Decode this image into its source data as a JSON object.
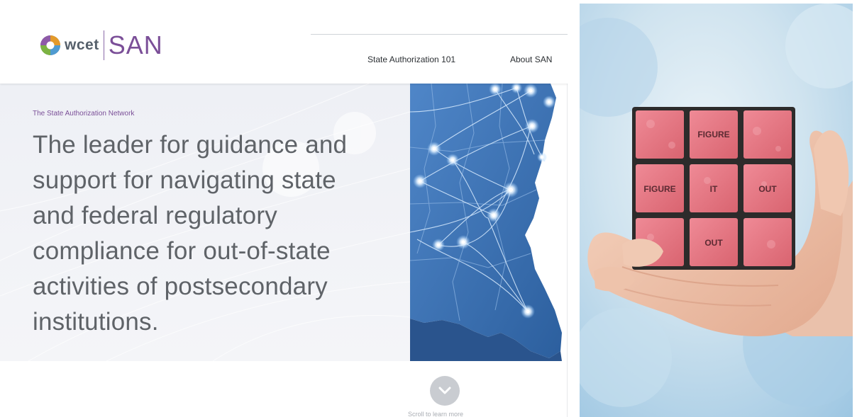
{
  "brand": {
    "logo_wcet": "wcet",
    "logo_san": "SAN",
    "accent_color": "#7b4f98"
  },
  "nav": {
    "items": [
      {
        "label": "State Authorization 101"
      },
      {
        "label": "About SAN"
      }
    ]
  },
  "hero": {
    "kicker": "The State Authorization Network",
    "headline": "The leader for guidance and support for navigating state and federal regulatory compliance for out-of-state activities of postsecondary institutions.",
    "headline_lines": [
      "The leader for guidance and",
      "support for navigating state",
      "and federal regulatory",
      "compliance for out-of-state",
      "activities of postsecondary",
      "institutions."
    ],
    "map_icon": "us-map-network-image"
  },
  "scroll": {
    "icon": "chevron-down-icon",
    "text": "Scroll to learn more"
  },
  "photo": {
    "description_icon": "hand-holding-cube-image",
    "cube_tiles": [
      "",
      "FIGURE",
      "",
      "FIGURE",
      "IT",
      "OUT",
      "",
      "OUT",
      ""
    ]
  }
}
